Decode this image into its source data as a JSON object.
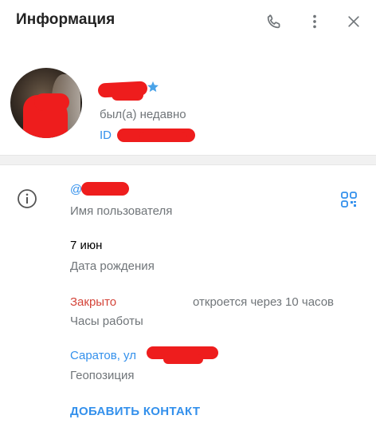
{
  "header": {
    "title": "Информация",
    "icons": [
      "phone-icon",
      "more-vertical-icon",
      "close-icon"
    ]
  },
  "profile": {
    "status": "был(а) недавно",
    "id_prefix": "ID",
    "name_icon": "star-icon"
  },
  "info": {
    "username_prefix": "@",
    "username_label": "Имя пользователя",
    "birthday_value": "7 июн",
    "birthday_label": "Дата рождения",
    "hours_status": "Закрыто",
    "hours_note": "откроется через 10 часов",
    "hours_label": "Часы работы",
    "location_value": "Саратов, ул",
    "location_label": "Геопозиция",
    "add_contact": "ДОБАВИТЬ КОНТАКТ"
  },
  "colors": {
    "accent": "#3390ec",
    "muted": "#707579",
    "closed": "#d4453a",
    "redaction": "#ee1d1d"
  }
}
